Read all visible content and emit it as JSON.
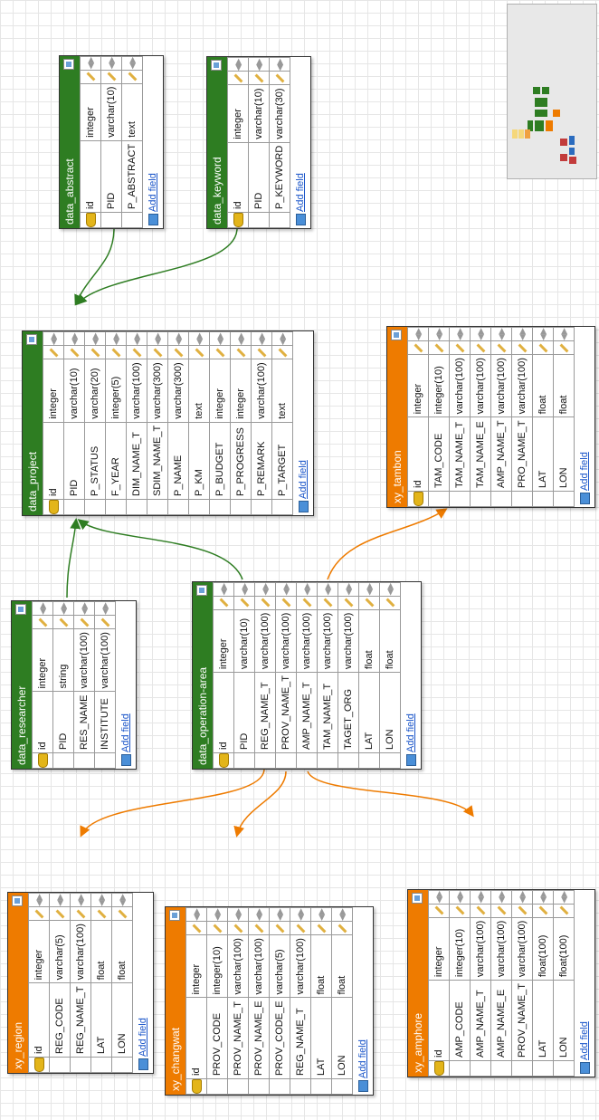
{
  "add_field_label": "Add field",
  "colors": {
    "green": "#2e7d22",
    "orange": "#ee7b00"
  },
  "icons": {
    "primary_key": "key-icon",
    "edit": "pencil-icon",
    "arrange": "move-arrows-icon",
    "add": "add-field-icon",
    "table": "table-icon"
  },
  "tables": [
    {
      "id": "data_abstract",
      "name": "data_abstract",
      "color": "green",
      "fields": [
        {
          "name": "id",
          "type": "integer",
          "pk": true
        },
        {
          "name": "PID",
          "type": "varchar(10)"
        },
        {
          "name": "P_ABSTRACT",
          "type": "text"
        }
      ]
    },
    {
      "id": "data_keyword",
      "name": "data_keyword",
      "color": "green",
      "fields": [
        {
          "name": "id",
          "type": "integer",
          "pk": true
        },
        {
          "name": "PID",
          "type": "varchar(10)"
        },
        {
          "name": "P_KEYWORD",
          "type": "varchar(30)"
        }
      ]
    },
    {
      "id": "data_project",
      "name": "data_project",
      "color": "green",
      "fields": [
        {
          "name": "id",
          "type": "integer",
          "pk": true
        },
        {
          "name": "PID",
          "type": "varchar(10)"
        },
        {
          "name": "P_STATUS",
          "type": "varchar(20)"
        },
        {
          "name": "F_YEAR",
          "type": "integer(5)"
        },
        {
          "name": "DIM_NAME_T",
          "type": "varchar(100)"
        },
        {
          "name": "SDIM_NAME_T",
          "type": "varchar(300)"
        },
        {
          "name": "P_NAME",
          "type": "varchar(300)"
        },
        {
          "name": "P_KM",
          "type": "text"
        },
        {
          "name": "P_BUDGET",
          "type": "integer"
        },
        {
          "name": "P_PROGRESS",
          "type": "integer"
        },
        {
          "name": "P_REMARK",
          "type": "varchar(100)"
        },
        {
          "name": "P_TARGET",
          "type": "text"
        }
      ]
    },
    {
      "id": "xy_tambon",
      "name": "xy_tambon",
      "color": "orange",
      "fields": [
        {
          "name": "id",
          "type": "integer",
          "pk": true
        },
        {
          "name": "TAM_CODE",
          "type": "integer(10)"
        },
        {
          "name": "TAM_NAME_T",
          "type": "varchar(100)"
        },
        {
          "name": "TAM_NAME_E",
          "type": "varchar(100)"
        },
        {
          "name": "AMP_NAME_T",
          "type": "varchar(100)"
        },
        {
          "name": "PRO_NAME_T",
          "type": "varchar(100)"
        },
        {
          "name": "LAT",
          "type": "float"
        },
        {
          "name": "LON",
          "type": "float"
        }
      ]
    },
    {
      "id": "data_researcher",
      "name": "data_researcher",
      "color": "green",
      "fields": [
        {
          "name": "id",
          "type": "integer",
          "pk": true
        },
        {
          "name": "PID",
          "type": "string"
        },
        {
          "name": "RES_NAME",
          "type": "varchar(100)"
        },
        {
          "name": "INSTITUTE",
          "type": "varchar(100)"
        }
      ]
    },
    {
      "id": "data_operation_area",
      "name": "data_operation-area",
      "color": "green",
      "fields": [
        {
          "name": "id",
          "type": "integer",
          "pk": true
        },
        {
          "name": "PID",
          "type": "varchar(10)"
        },
        {
          "name": "REG_NAME_T",
          "type": "varchar(100)"
        },
        {
          "name": "PROV_NAME_T",
          "type": "varchar(100)"
        },
        {
          "name": "AMP_NAME_T",
          "type": "varchar(100)"
        },
        {
          "name": "TAM_NAME_T",
          "type": "varchar(100)"
        },
        {
          "name": "TAGET_ORG",
          "type": "varchar(100)"
        },
        {
          "name": "LAT",
          "type": "float"
        },
        {
          "name": "LON",
          "type": "float"
        }
      ]
    },
    {
      "id": "xy_region",
      "name": "xy_region",
      "color": "orange",
      "fields": [
        {
          "name": "id",
          "type": "integer",
          "pk": true
        },
        {
          "name": "REG_CODE",
          "type": "varchar(5)"
        },
        {
          "name": "REG_NAME_T",
          "type": "varchar(100)"
        },
        {
          "name": "LAT",
          "type": "float"
        },
        {
          "name": "LON",
          "type": "float"
        }
      ]
    },
    {
      "id": "xy_changwat",
      "name": "xy_changwat",
      "color": "orange",
      "fields": [
        {
          "name": "id",
          "type": "integer",
          "pk": true
        },
        {
          "name": "PROV_CODE",
          "type": "integer(10)"
        },
        {
          "name": "PROV_NAME_T",
          "type": "varchar(100)"
        },
        {
          "name": "PROV_NAME_E",
          "type": "varchar(100)"
        },
        {
          "name": "PROV_CODE_E",
          "type": "varchar(5)"
        },
        {
          "name": "REG_NAME_T",
          "type": "varchar(100)"
        },
        {
          "name": "LAT",
          "type": "float"
        },
        {
          "name": "LON",
          "type": "float"
        }
      ]
    },
    {
      "id": "xy_amphore",
      "name": "xy_amphore",
      "color": "orange",
      "fields": [
        {
          "name": "id",
          "type": "integer",
          "pk": true
        },
        {
          "name": "AMP_CODE",
          "type": "integer(10)"
        },
        {
          "name": "AMP_NAME_T",
          "type": "varchar(100)"
        },
        {
          "name": "AMP_NAME_E",
          "type": "varchar(100)"
        },
        {
          "name": "PROV_NAME_T",
          "type": "varchar(100)"
        },
        {
          "name": "LAT",
          "type": "float(100)"
        },
        {
          "name": "LON",
          "type": "float(100)"
        }
      ]
    }
  ],
  "relations": [
    {
      "from": "data_abstract",
      "to": "data_project",
      "color": "green"
    },
    {
      "from": "data_keyword",
      "to": "data_project",
      "color": "green"
    },
    {
      "from": "data_researcher",
      "to": "data_project",
      "color": "green"
    },
    {
      "from": "data_operation_area",
      "to": "data_project",
      "color": "green"
    },
    {
      "from": "data_operation_area",
      "to": "xy_tambon",
      "color": "orange"
    },
    {
      "from": "data_operation_area",
      "to": "xy_region",
      "color": "orange"
    },
    {
      "from": "data_operation_area",
      "to": "xy_changwat",
      "color": "orange"
    },
    {
      "from": "data_operation_area",
      "to": "xy_amphore",
      "color": "orange"
    }
  ]
}
